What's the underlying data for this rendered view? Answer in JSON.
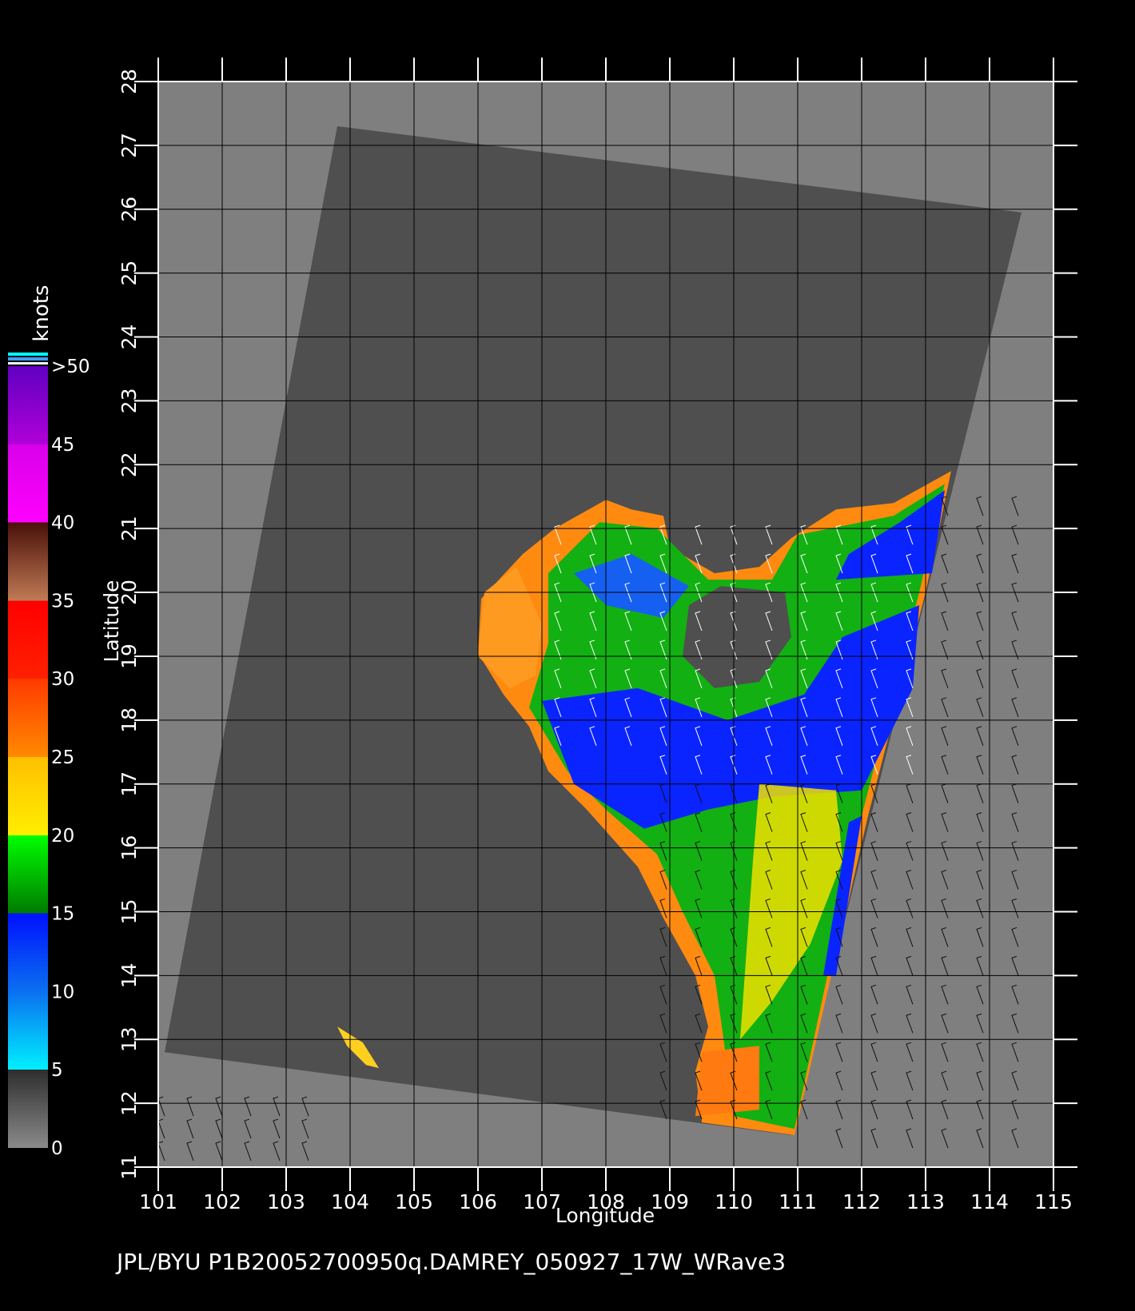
{
  "colors": {
    "background": "#000000",
    "frame": "#7f7f7f",
    "swath": "#4f4f4f",
    "grid": "#000000",
    "text": "#ffffff"
  },
  "map": {
    "xlabel": "Longitude",
    "ylabel": "Latitude",
    "lon_range": [
      101,
      115
    ],
    "lat_range": [
      11,
      28
    ],
    "lon_ticks": [
      "101",
      "102",
      "103",
      "104",
      "105",
      "106",
      "107",
      "108",
      "109",
      "110",
      "111",
      "112",
      "113",
      "114",
      "115"
    ],
    "lat_ticks": [
      "11",
      "12",
      "13",
      "14",
      "15",
      "16",
      "17",
      "18",
      "19",
      "20",
      "21",
      "22",
      "23",
      "24",
      "25",
      "26",
      "27",
      "28"
    ],
    "grid": true,
    "swath_corners_lonlat": [
      [
        103.8,
        27.3
      ],
      [
        114.5,
        25.95
      ],
      [
        110.9,
        11.5
      ],
      [
        101.1,
        12.8
      ]
    ]
  },
  "colorbar": {
    "unit": "knots",
    "labels": [
      "0",
      "5",
      "10",
      "15",
      "20",
      "25",
      "30",
      "35",
      "40",
      "45",
      ">50"
    ],
    "bands": [
      {
        "from": 0,
        "to": 5,
        "colors": [
          "#8a8a8a",
          "#2e2e2e"
        ]
      },
      {
        "from": 5,
        "to": 10,
        "colors": [
          "#00f0ff",
          "#0a70f0"
        ]
      },
      {
        "from": 10,
        "to": 15,
        "colors": [
          "#0a70f0",
          "#0010ff"
        ]
      },
      {
        "from": 15,
        "to": 20,
        "colors": [
          "#007a00",
          "#00ff00"
        ]
      },
      {
        "from": 20,
        "to": 25,
        "colors": [
          "#ffee00",
          "#ffbf00"
        ]
      },
      {
        "from": 25,
        "to": 30,
        "colors": [
          "#ff8a00",
          "#ff3a00"
        ]
      },
      {
        "from": 30,
        "to": 35,
        "colors": [
          "#ff2000",
          "#ff0000"
        ]
      },
      {
        "from": 35,
        "to": 40,
        "colors": [
          "#c07a55",
          "#4a1008"
        ]
      },
      {
        "from": 40,
        "to": 45,
        "colors": [
          "#ff00ff",
          "#d800e8"
        ]
      },
      {
        "from": 45,
        "to": 50,
        "colors": [
          "#b000d8",
          "#6000c0"
        ]
      }
    ]
  },
  "caption": "JPL/BYU  P1B20052700950q.DAMREY_050927_17W_WRave3"
}
